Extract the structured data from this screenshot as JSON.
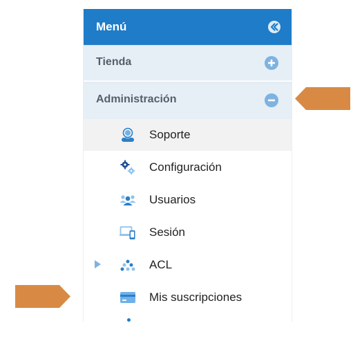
{
  "menu": {
    "title": "Menú",
    "collapse_icon": "double-chevron-left-icon",
    "sections": [
      {
        "label": "Tienda",
        "icon": "plus-circle-icon",
        "expanded": false
      },
      {
        "label": "Administración",
        "icon": "minus-circle-icon",
        "expanded": true
      }
    ],
    "items": [
      {
        "label": "Soporte",
        "icon": "support-agent-icon",
        "active": true
      },
      {
        "label": "Configuración",
        "icon": "gears-icon"
      },
      {
        "label": "Usuarios",
        "icon": "users-icon"
      },
      {
        "label": "Sesión",
        "icon": "devices-icon"
      },
      {
        "label": "ACL",
        "icon": "dots-cluster-icon",
        "has_children": true
      },
      {
        "label": "Mis suscripciones",
        "icon": "card-icon"
      }
    ]
  },
  "annotations": {
    "arrow_color": "#d88a44",
    "arrows": [
      {
        "points_to": "Administración",
        "direction": "left"
      },
      {
        "points_to": "Mis suscripciones",
        "direction": "right"
      }
    ]
  },
  "colors": {
    "header_bg": "#1e7cc8",
    "section_bg": "#e6eef6",
    "toggle_icon": "#7fb2e0",
    "active_row": "#f2f2f2"
  }
}
